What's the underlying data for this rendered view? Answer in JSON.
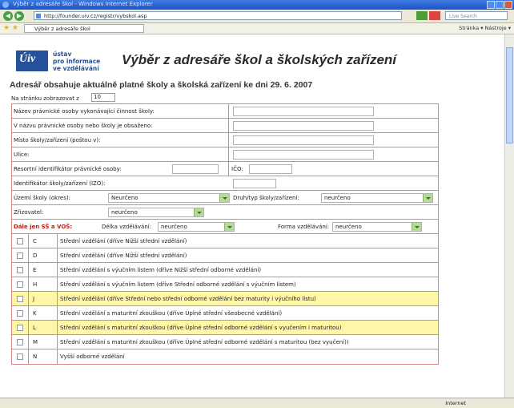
{
  "window": {
    "title": "Výběr z adresáře škol - Windows Internet Explorer",
    "address": "http://founder.uiv.cz/registr/vybskol.asp",
    "search_placeholder": "Live Search",
    "tab_label": "Výběr z adresáře škol",
    "tools_text": "Stránka ▾  Nástroje ▾",
    "status_text": "Internet"
  },
  "header": {
    "logo_text": "Úiv",
    "org_lines": [
      "ústav",
      "pro informace",
      "ve vzdělávání"
    ],
    "title": "Výběr z adresáře škol a školských zařízení",
    "subtitle": "Adresář obsahuje aktuálně platné školy a školská zařízení ke dni 29. 6. 2007"
  },
  "paging": {
    "label": "Na stránku zobrazovat z",
    "value": "10"
  },
  "form": {
    "name_label": "Název právnické osoby vykonávající činnost školy:",
    "contains_label": "V názvu právnické osoby nebo školy je obsaženo:",
    "place_label": "Místo školy/zařízení (poštou v):",
    "street_label": "Ulice:",
    "resort_label": "Resortní identifikátor právnické osoby:",
    "ico_label": "IČO:",
    "izo_label": "Identifikátor školy/zařízení (IZO):",
    "territory_label": "Území školy (okres):",
    "territory_value": "Neurčeno",
    "type_label": "Druh/typ školy/zařízení:",
    "type_value": "neurčeno",
    "founder_label": "Zřizovatel:",
    "founder_value": "neurčeno",
    "ss_label": "Dále jen SŠ a VOŠ:",
    "length_label": "Délka vzdělávání:",
    "length_value": "neurčeno",
    "form_label": "Forma vzdělávání:",
    "form_value": "neurčeno"
  },
  "education_levels": [
    {
      "code": "C",
      "description": "Střední vzdělání (dříve Nižší střední vzdělání)"
    },
    {
      "code": "D",
      "description": "Střední vzdělání (dříve Nižší střední vzdělání)"
    },
    {
      "code": "E",
      "description": "Střední vzdělání s výučním listem (dříve Nižší střední odborné vzdělání)"
    },
    {
      "code": "H",
      "description": "Střední vzdělání s výučním listem (dříve Střední odborné vzdělání s výučním listem)"
    },
    {
      "code": "J",
      "description": "Střední vzdělání (dříve Střední nebo střední odborné vzdělání bez maturity i výučního listu)"
    },
    {
      "code": "K",
      "description": "Střední vzdělání s maturitní zkouškou (dříve Úplné střední všeobecné vzdělání)"
    },
    {
      "code": "L",
      "description": "Střední vzdělání s maturitní zkouškou (dříve Úplné střední odborné vzdělání s vyučením i maturitou)"
    },
    {
      "code": "M",
      "description": "Střední vzdělání s maturitní zkouškou (dříve Úplné střední odborné vzdělání s maturitou (bez vyučení))"
    },
    {
      "code": "N",
      "description": "Vyšší odborné vzdělání"
    }
  ],
  "colors": {
    "border": "#d48a8a",
    "highlight_row": "#fff6a8",
    "accent": "#27509b"
  }
}
